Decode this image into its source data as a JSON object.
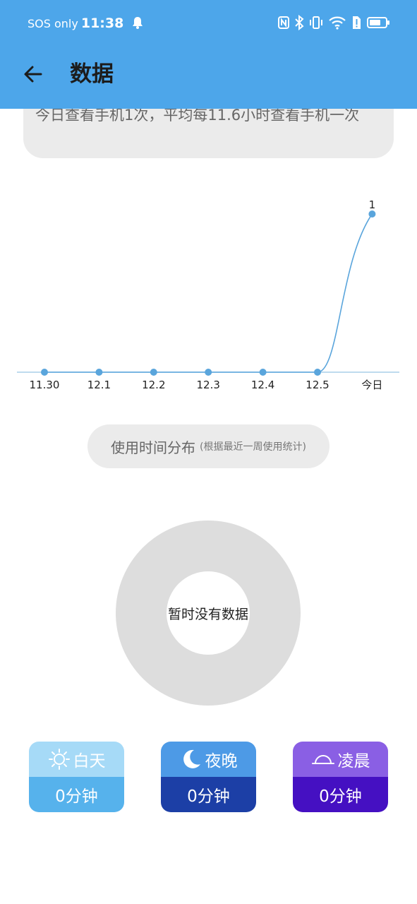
{
  "status_bar": {
    "carrier": "SOS only",
    "time": "11:38",
    "icons": [
      "bell-icon",
      "nfc-icon",
      "bluetooth-icon",
      "vibrate-icon",
      "wifi-icon",
      "sim-alert-icon",
      "battery-icon"
    ]
  },
  "header": {
    "title": "数据",
    "back_icon": "arrow-left-icon",
    "background": "#4da6ea"
  },
  "summary": {
    "text": "今日查看手机1次，平均每11.6小时查看手机一次"
  },
  "chart_data": {
    "type": "line",
    "categories": [
      "11.30",
      "12.1",
      "12.2",
      "12.3",
      "12.4",
      "12.5",
      "今日"
    ],
    "values": [
      0,
      0,
      0,
      0,
      0,
      0,
      1
    ],
    "data_labels": [
      "",
      "",
      "",
      "",
      "",
      "",
      "1"
    ],
    "color": "#5aa5dc",
    "ylim": [
      0,
      1
    ],
    "grid": false,
    "legend": "none"
  },
  "distribution": {
    "title": "使用时间分布",
    "subtitle": "(根据最近一周使用统计)",
    "empty_text": "暂时没有数据",
    "donut_color": "#dddddd"
  },
  "time_cards": [
    {
      "label": "白天",
      "value": "0分钟",
      "icon": "sun-icon",
      "top_color": "#a6daf7",
      "bottom_color": "#56b2ec"
    },
    {
      "label": "夜晚",
      "value": "0分钟",
      "icon": "moon-icon",
      "top_color": "#4d9ae6",
      "bottom_color": "#1c3fa6"
    },
    {
      "label": "凌晨",
      "value": "0分钟",
      "icon": "sunrise-icon",
      "top_color": "#8a5fe4",
      "bottom_color": "#4510c2"
    }
  ]
}
